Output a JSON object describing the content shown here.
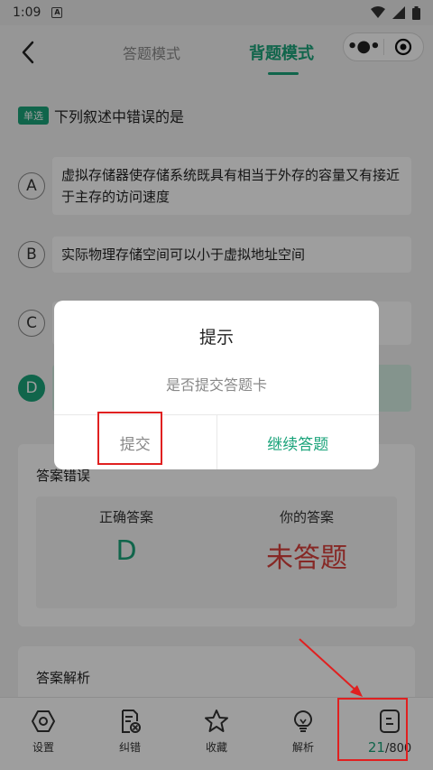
{
  "status": {
    "time": "1:09",
    "notif_icon": "A"
  },
  "header": {
    "tab_answer": "答题模式",
    "tab_recite": "背题模式"
  },
  "question": {
    "type": "单选",
    "text": "下列叙述中错误的是",
    "options": [
      {
        "letter": "A",
        "text": "虚拟存储器使存储系统既具有相当于外存的容量又有接近于主存的访问速度"
      },
      {
        "letter": "B",
        "text": "实际物理存储空间可以小于虚拟地址空间"
      },
      {
        "letter": "C",
        "text": ""
      },
      {
        "letter": "D",
        "text": ""
      }
    ]
  },
  "answer_card": {
    "title": "答案错误",
    "correct_label": "正确答案",
    "correct_value": "D",
    "yours_label": "你的答案",
    "yours_value": "未答题"
  },
  "analysis": {
    "title": "答案解析"
  },
  "bottom_bar": {
    "settings": "设置",
    "report": "纠错",
    "favorite": "收藏",
    "explain": "解析",
    "progress_current": "21",
    "progress_total": "/800"
  },
  "dialog": {
    "title": "提示",
    "message": "是否提交答题卡",
    "submit": "提交",
    "continue": "继续答题"
  },
  "colors": {
    "accent": "#1aa37a",
    "error": "#d9413d",
    "highlight": "#e02020"
  }
}
